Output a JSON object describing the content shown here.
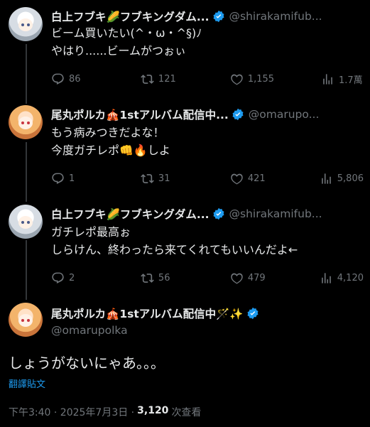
{
  "tweets": [
    {
      "name": "白上フブキ🌽フブキングダム...",
      "handle": "@shirakamifub...",
      "body": "ビーム買いたい(^・ω・^§)ﾉ\nやはり......ビームがつぉぃ",
      "reply": "86",
      "retweet": "121",
      "like": "1,155",
      "views": "1.7萬"
    },
    {
      "name": "尾丸ポルカ🎪1stアルバム配信中...",
      "handle": "@omarupo...",
      "body": "もう病みつきだよな！\n今度ガチレポ👊🔥しよ",
      "reply": "1",
      "retweet": "31",
      "like": "421",
      "views": "5,806"
    },
    {
      "name": "白上フブキ🌽フブキングダム...",
      "handle": "@shirakamifub...",
      "body": "ガチレポ最高ぉ\nしらけん、終わったら来てくれてもいいんだよ←",
      "reply": "2",
      "retweet": "56",
      "like": "479",
      "views": "4,120"
    }
  ],
  "focused": {
    "name": "尾丸ポルカ🎪1stアルバム配信中🪄✨",
    "handle": "@omarupolka",
    "body": "しょうがないにゃあ。。。",
    "translate": "翻譯貼文",
    "time": "下午3:40 · 2025年7月3日 ·",
    "views_count": "3,120",
    "views_label": "次查看"
  },
  "colors": {
    "accent": "#1d9bf0",
    "muted": "#71767b",
    "text": "#e7e9ea",
    "bg": "#000000"
  }
}
